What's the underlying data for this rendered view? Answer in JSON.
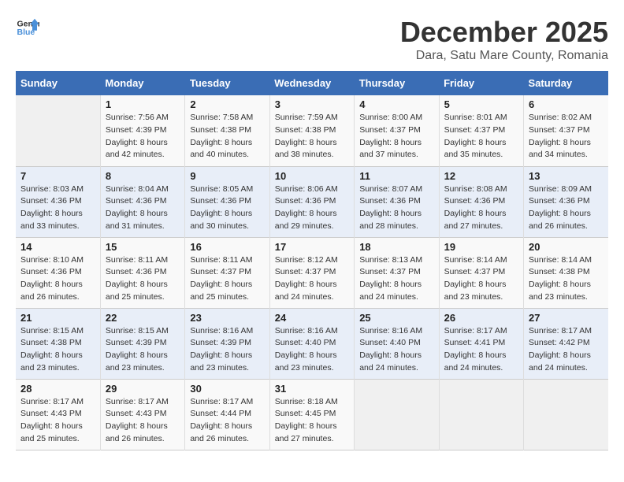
{
  "logo": {
    "line1": "General",
    "line2": "Blue"
  },
  "title": "December 2025",
  "location": "Dara, Satu Mare County, Romania",
  "weekdays": [
    "Sunday",
    "Monday",
    "Tuesday",
    "Wednesday",
    "Thursday",
    "Friday",
    "Saturday"
  ],
  "weeks": [
    [
      {
        "day": "",
        "info": ""
      },
      {
        "day": "1",
        "info": "Sunrise: 7:56 AM\nSunset: 4:39 PM\nDaylight: 8 hours\nand 42 minutes."
      },
      {
        "day": "2",
        "info": "Sunrise: 7:58 AM\nSunset: 4:38 PM\nDaylight: 8 hours\nand 40 minutes."
      },
      {
        "day": "3",
        "info": "Sunrise: 7:59 AM\nSunset: 4:38 PM\nDaylight: 8 hours\nand 38 minutes."
      },
      {
        "day": "4",
        "info": "Sunrise: 8:00 AM\nSunset: 4:37 PM\nDaylight: 8 hours\nand 37 minutes."
      },
      {
        "day": "5",
        "info": "Sunrise: 8:01 AM\nSunset: 4:37 PM\nDaylight: 8 hours\nand 35 minutes."
      },
      {
        "day": "6",
        "info": "Sunrise: 8:02 AM\nSunset: 4:37 PM\nDaylight: 8 hours\nand 34 minutes."
      }
    ],
    [
      {
        "day": "7",
        "info": "Sunrise: 8:03 AM\nSunset: 4:36 PM\nDaylight: 8 hours\nand 33 minutes."
      },
      {
        "day": "8",
        "info": "Sunrise: 8:04 AM\nSunset: 4:36 PM\nDaylight: 8 hours\nand 31 minutes."
      },
      {
        "day": "9",
        "info": "Sunrise: 8:05 AM\nSunset: 4:36 PM\nDaylight: 8 hours\nand 30 minutes."
      },
      {
        "day": "10",
        "info": "Sunrise: 8:06 AM\nSunset: 4:36 PM\nDaylight: 8 hours\nand 29 minutes."
      },
      {
        "day": "11",
        "info": "Sunrise: 8:07 AM\nSunset: 4:36 PM\nDaylight: 8 hours\nand 28 minutes."
      },
      {
        "day": "12",
        "info": "Sunrise: 8:08 AM\nSunset: 4:36 PM\nDaylight: 8 hours\nand 27 minutes."
      },
      {
        "day": "13",
        "info": "Sunrise: 8:09 AM\nSunset: 4:36 PM\nDaylight: 8 hours\nand 26 minutes."
      }
    ],
    [
      {
        "day": "14",
        "info": "Sunrise: 8:10 AM\nSunset: 4:36 PM\nDaylight: 8 hours\nand 26 minutes."
      },
      {
        "day": "15",
        "info": "Sunrise: 8:11 AM\nSunset: 4:36 PM\nDaylight: 8 hours\nand 25 minutes."
      },
      {
        "day": "16",
        "info": "Sunrise: 8:11 AM\nSunset: 4:37 PM\nDaylight: 8 hours\nand 25 minutes."
      },
      {
        "day": "17",
        "info": "Sunrise: 8:12 AM\nSunset: 4:37 PM\nDaylight: 8 hours\nand 24 minutes."
      },
      {
        "day": "18",
        "info": "Sunrise: 8:13 AM\nSunset: 4:37 PM\nDaylight: 8 hours\nand 24 minutes."
      },
      {
        "day": "19",
        "info": "Sunrise: 8:14 AM\nSunset: 4:37 PM\nDaylight: 8 hours\nand 23 minutes."
      },
      {
        "day": "20",
        "info": "Sunrise: 8:14 AM\nSunset: 4:38 PM\nDaylight: 8 hours\nand 23 minutes."
      }
    ],
    [
      {
        "day": "21",
        "info": "Sunrise: 8:15 AM\nSunset: 4:38 PM\nDaylight: 8 hours\nand 23 minutes."
      },
      {
        "day": "22",
        "info": "Sunrise: 8:15 AM\nSunset: 4:39 PM\nDaylight: 8 hours\nand 23 minutes."
      },
      {
        "day": "23",
        "info": "Sunrise: 8:16 AM\nSunset: 4:39 PM\nDaylight: 8 hours\nand 23 minutes."
      },
      {
        "day": "24",
        "info": "Sunrise: 8:16 AM\nSunset: 4:40 PM\nDaylight: 8 hours\nand 23 minutes."
      },
      {
        "day": "25",
        "info": "Sunrise: 8:16 AM\nSunset: 4:40 PM\nDaylight: 8 hours\nand 24 minutes."
      },
      {
        "day": "26",
        "info": "Sunrise: 8:17 AM\nSunset: 4:41 PM\nDaylight: 8 hours\nand 24 minutes."
      },
      {
        "day": "27",
        "info": "Sunrise: 8:17 AM\nSunset: 4:42 PM\nDaylight: 8 hours\nand 24 minutes."
      }
    ],
    [
      {
        "day": "28",
        "info": "Sunrise: 8:17 AM\nSunset: 4:43 PM\nDaylight: 8 hours\nand 25 minutes."
      },
      {
        "day": "29",
        "info": "Sunrise: 8:17 AM\nSunset: 4:43 PM\nDaylight: 8 hours\nand 26 minutes."
      },
      {
        "day": "30",
        "info": "Sunrise: 8:17 AM\nSunset: 4:44 PM\nDaylight: 8 hours\nand 26 minutes."
      },
      {
        "day": "31",
        "info": "Sunrise: 8:18 AM\nSunset: 4:45 PM\nDaylight: 8 hours\nand 27 minutes."
      },
      {
        "day": "",
        "info": ""
      },
      {
        "day": "",
        "info": ""
      },
      {
        "day": "",
        "info": ""
      }
    ]
  ]
}
